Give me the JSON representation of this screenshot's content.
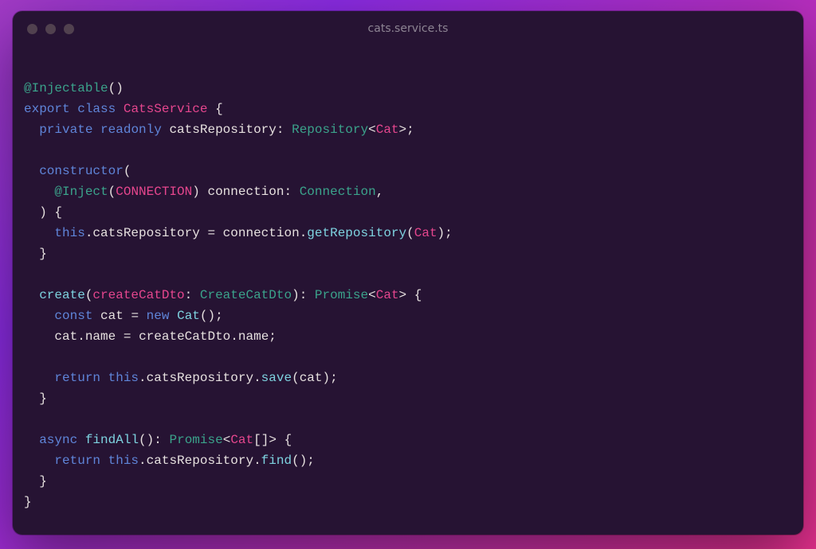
{
  "window": {
    "title": "cats.service.ts"
  },
  "code": {
    "tokens": [
      [
        {
          "t": "@",
          "c": "tok-dec"
        },
        {
          "t": "Injectable",
          "c": "tok-dec"
        },
        {
          "t": "(",
          "c": "tok-punc"
        },
        {
          "t": ")",
          "c": "tok-punc"
        }
      ],
      [
        {
          "t": "export",
          "c": "tok-kw"
        },
        {
          "t": " ",
          "c": ""
        },
        {
          "t": "class",
          "c": "tok-kw"
        },
        {
          "t": " ",
          "c": ""
        },
        {
          "t": "CatsService",
          "c": "tok-class"
        },
        {
          "t": " ",
          "c": ""
        },
        {
          "t": "{",
          "c": "tok-punc"
        }
      ],
      [
        {
          "t": "  ",
          "c": ""
        },
        {
          "t": "private",
          "c": "tok-kw"
        },
        {
          "t": " ",
          "c": ""
        },
        {
          "t": "readonly",
          "c": "tok-kw"
        },
        {
          "t": " ",
          "c": ""
        },
        {
          "t": "catsRepository",
          "c": "tok-ident"
        },
        {
          "t": ":",
          "c": "tok-punc"
        },
        {
          "t": " ",
          "c": ""
        },
        {
          "t": "Repository",
          "c": "tok-type"
        },
        {
          "t": "<",
          "c": "tok-punc"
        },
        {
          "t": "Cat",
          "c": "tok-class"
        },
        {
          "t": ">",
          "c": "tok-punc"
        },
        {
          "t": ";",
          "c": "tok-punc"
        }
      ],
      [
        {
          "t": "",
          "c": ""
        }
      ],
      [
        {
          "t": "  ",
          "c": ""
        },
        {
          "t": "constructor",
          "c": "tok-kw"
        },
        {
          "t": "(",
          "c": "tok-punc"
        }
      ],
      [
        {
          "t": "    ",
          "c": ""
        },
        {
          "t": "@",
          "c": "tok-dec"
        },
        {
          "t": "Inject",
          "c": "tok-dec"
        },
        {
          "t": "(",
          "c": "tok-punc"
        },
        {
          "t": "CONNECTION",
          "c": "tok-class"
        },
        {
          "t": ")",
          "c": "tok-punc"
        },
        {
          "t": " ",
          "c": ""
        },
        {
          "t": "connection",
          "c": "tok-ident"
        },
        {
          "t": ":",
          "c": "tok-punc"
        },
        {
          "t": " ",
          "c": ""
        },
        {
          "t": "Connection",
          "c": "tok-type"
        },
        {
          "t": ",",
          "c": "tok-punc"
        }
      ],
      [
        {
          "t": "  ",
          "c": ""
        },
        {
          "t": ")",
          "c": "tok-punc"
        },
        {
          "t": " ",
          "c": ""
        },
        {
          "t": "{",
          "c": "tok-punc"
        }
      ],
      [
        {
          "t": "    ",
          "c": ""
        },
        {
          "t": "this",
          "c": "tok-kw"
        },
        {
          "t": ".",
          "c": "tok-punc"
        },
        {
          "t": "catsRepository",
          "c": "tok-ident"
        },
        {
          "t": " ",
          "c": ""
        },
        {
          "t": "=",
          "c": "tok-punc"
        },
        {
          "t": " ",
          "c": ""
        },
        {
          "t": "connection",
          "c": "tok-ident"
        },
        {
          "t": ".",
          "c": "tok-punc"
        },
        {
          "t": "getRepository",
          "c": "tok-func"
        },
        {
          "t": "(",
          "c": "tok-punc"
        },
        {
          "t": "Cat",
          "c": "tok-class"
        },
        {
          "t": ")",
          "c": "tok-punc"
        },
        {
          "t": ";",
          "c": "tok-punc"
        }
      ],
      [
        {
          "t": "  ",
          "c": ""
        },
        {
          "t": "}",
          "c": "tok-punc"
        }
      ],
      [
        {
          "t": "",
          "c": ""
        }
      ],
      [
        {
          "t": "  ",
          "c": ""
        },
        {
          "t": "create",
          "c": "tok-func"
        },
        {
          "t": "(",
          "c": "tok-punc"
        },
        {
          "t": "createCatDto",
          "c": "tok-class"
        },
        {
          "t": ":",
          "c": "tok-punc"
        },
        {
          "t": " ",
          "c": ""
        },
        {
          "t": "CreateCatDto",
          "c": "tok-type"
        },
        {
          "t": ")",
          "c": "tok-punc"
        },
        {
          "t": ":",
          "c": "tok-punc"
        },
        {
          "t": " ",
          "c": ""
        },
        {
          "t": "Promise",
          "c": "tok-type"
        },
        {
          "t": "<",
          "c": "tok-punc"
        },
        {
          "t": "Cat",
          "c": "tok-class"
        },
        {
          "t": ">",
          "c": "tok-punc"
        },
        {
          "t": " ",
          "c": ""
        },
        {
          "t": "{",
          "c": "tok-punc"
        }
      ],
      [
        {
          "t": "    ",
          "c": ""
        },
        {
          "t": "const",
          "c": "tok-kw"
        },
        {
          "t": " ",
          "c": ""
        },
        {
          "t": "cat",
          "c": "tok-ident"
        },
        {
          "t": " ",
          "c": ""
        },
        {
          "t": "=",
          "c": "tok-punc"
        },
        {
          "t": " ",
          "c": ""
        },
        {
          "t": "new",
          "c": "tok-kw"
        },
        {
          "t": " ",
          "c": ""
        },
        {
          "t": "Cat",
          "c": "tok-func"
        },
        {
          "t": "(",
          "c": "tok-punc"
        },
        {
          "t": ")",
          "c": "tok-punc"
        },
        {
          "t": ";",
          "c": "tok-punc"
        }
      ],
      [
        {
          "t": "    ",
          "c": ""
        },
        {
          "t": "cat",
          "c": "tok-ident"
        },
        {
          "t": ".",
          "c": "tok-punc"
        },
        {
          "t": "name",
          "c": "tok-ident"
        },
        {
          "t": " ",
          "c": ""
        },
        {
          "t": "=",
          "c": "tok-punc"
        },
        {
          "t": " ",
          "c": ""
        },
        {
          "t": "createCatDto",
          "c": "tok-ident"
        },
        {
          "t": ".",
          "c": "tok-punc"
        },
        {
          "t": "name",
          "c": "tok-ident"
        },
        {
          "t": ";",
          "c": "tok-punc"
        }
      ],
      [
        {
          "t": "",
          "c": ""
        }
      ],
      [
        {
          "t": "    ",
          "c": ""
        },
        {
          "t": "return",
          "c": "tok-kw"
        },
        {
          "t": " ",
          "c": ""
        },
        {
          "t": "this",
          "c": "tok-kw"
        },
        {
          "t": ".",
          "c": "tok-punc"
        },
        {
          "t": "catsRepository",
          "c": "tok-ident"
        },
        {
          "t": ".",
          "c": "tok-punc"
        },
        {
          "t": "save",
          "c": "tok-func"
        },
        {
          "t": "(",
          "c": "tok-punc"
        },
        {
          "t": "cat",
          "c": "tok-ident"
        },
        {
          "t": ")",
          "c": "tok-punc"
        },
        {
          "t": ";",
          "c": "tok-punc"
        }
      ],
      [
        {
          "t": "  ",
          "c": ""
        },
        {
          "t": "}",
          "c": "tok-punc"
        }
      ],
      [
        {
          "t": "",
          "c": ""
        }
      ],
      [
        {
          "t": "  ",
          "c": ""
        },
        {
          "t": "async",
          "c": "tok-kw"
        },
        {
          "t": " ",
          "c": ""
        },
        {
          "t": "findAll",
          "c": "tok-func"
        },
        {
          "t": "(",
          "c": "tok-punc"
        },
        {
          "t": ")",
          "c": "tok-punc"
        },
        {
          "t": ":",
          "c": "tok-punc"
        },
        {
          "t": " ",
          "c": ""
        },
        {
          "t": "Promise",
          "c": "tok-type"
        },
        {
          "t": "<",
          "c": "tok-punc"
        },
        {
          "t": "Cat",
          "c": "tok-class"
        },
        {
          "t": "[",
          "c": "tok-punc"
        },
        {
          "t": "]",
          "c": "tok-punc"
        },
        {
          "t": ">",
          "c": "tok-punc"
        },
        {
          "t": " ",
          "c": ""
        },
        {
          "t": "{",
          "c": "tok-punc"
        }
      ],
      [
        {
          "t": "    ",
          "c": ""
        },
        {
          "t": "return",
          "c": "tok-kw"
        },
        {
          "t": " ",
          "c": ""
        },
        {
          "t": "this",
          "c": "tok-kw"
        },
        {
          "t": ".",
          "c": "tok-punc"
        },
        {
          "t": "catsRepository",
          "c": "tok-ident"
        },
        {
          "t": ".",
          "c": "tok-punc"
        },
        {
          "t": "find",
          "c": "tok-func"
        },
        {
          "t": "(",
          "c": "tok-punc"
        },
        {
          "t": ")",
          "c": "tok-punc"
        },
        {
          "t": ";",
          "c": "tok-punc"
        }
      ],
      [
        {
          "t": "  ",
          "c": ""
        },
        {
          "t": "}",
          "c": "tok-punc"
        }
      ],
      [
        {
          "t": "}",
          "c": "tok-punc"
        }
      ]
    ]
  }
}
